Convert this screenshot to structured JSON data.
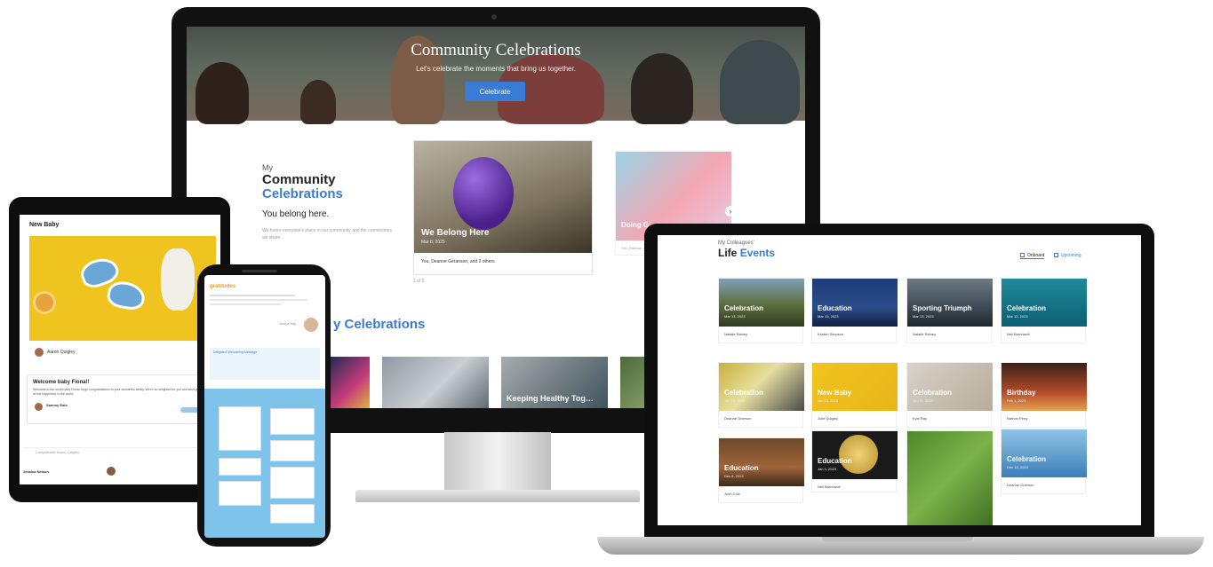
{
  "colors": {
    "accent": "#3a7bd5",
    "brand_orange": "#f29b1e",
    "phone_panel": "#7ec4ea"
  },
  "monitor": {
    "hero": {
      "title": "Community Celebrations",
      "subtitle": "Let's celebrate the moments that bring us together.",
      "button": "Celebrate"
    },
    "section": {
      "my": "My",
      "community": "Community",
      "celebrations": "Celebrations",
      "tagline": "You belong here.",
      "description": "We honor everyone's place in our community and the connections we share."
    },
    "featured": {
      "title": "We Belong Here",
      "date": "Mar 8, 2025",
      "people": "You, Deanne Geranson, and 2 others"
    },
    "second_card": {
      "title": "Doing G…",
      "date": "Mar 1…",
      "people": "You, Patricia…"
    },
    "pager": "1 of 5",
    "section2_title": "y Celebrations",
    "tiles": [
      {
        "label": ""
      },
      {
        "label": ""
      },
      {
        "label": "Keeping Healthy Tog…"
      },
      {
        "label": ""
      }
    ]
  },
  "tablet": {
    "title": "New Baby",
    "author": "Aaron Quigley",
    "card_title": "Welcome baby Fiona!!",
    "card_text": "Welcome to the world baby Fiona! Huge congratulations to your wonderful family. We're so delighted for you and wish your family all the happiness in the world.",
    "sender": "Sammy Eats",
    "comment_placeholder": "Congratulate Aaron Quigley",
    "bottom_name": "Jessica Nelson"
  },
  "phone": {
    "logo": "gratitudes",
    "sign": "Sonya Kay",
    "message_title": "Delighted! Welcoming Message"
  },
  "laptop": {
    "my": "My Colleagues'",
    "life": "Life",
    "events": "Events",
    "tabs": [
      "Onboard",
      "Upcoming"
    ],
    "cards": [
      {
        "title": "Celebration",
        "date": "Mar 13, 2023",
        "name": "Natalie Rainey"
      },
      {
        "title": "Education",
        "date": "Mar 13, 2023",
        "name": "Kristen Simpson"
      },
      {
        "title": "Sporting Triumph",
        "date": "Mar 13, 2023",
        "name": "Natalie Rainey"
      },
      {
        "title": "Celebration",
        "date": "Mar 13, 2023",
        "name": "Neil Barnhardt"
      },
      {
        "title": "Celebration",
        "date": "Jan 10, 2023",
        "name": "Deanne Grierson"
      },
      {
        "title": "New Baby",
        "date": "Jan 10, 2023",
        "name": "Julie Quigley"
      },
      {
        "title": "Celebration",
        "date": "Jan 11, 2023",
        "name": "Kyle Ray"
      },
      {
        "title": "Birthday",
        "date": "Feb 1, 2023",
        "name": "Nathan Perry"
      },
      {
        "title": "Education",
        "date": "Dec 8, 2023",
        "name": "Josh Cole"
      },
      {
        "title": "Education",
        "date": "Jan 4, 2023",
        "name": "Neil Barnhardt"
      },
      {
        "title": "",
        "date": "",
        "name": ""
      },
      {
        "title": "Celebration",
        "date": "Dec 18, 2023",
        "name": "Deanne Grierson"
      }
    ]
  }
}
